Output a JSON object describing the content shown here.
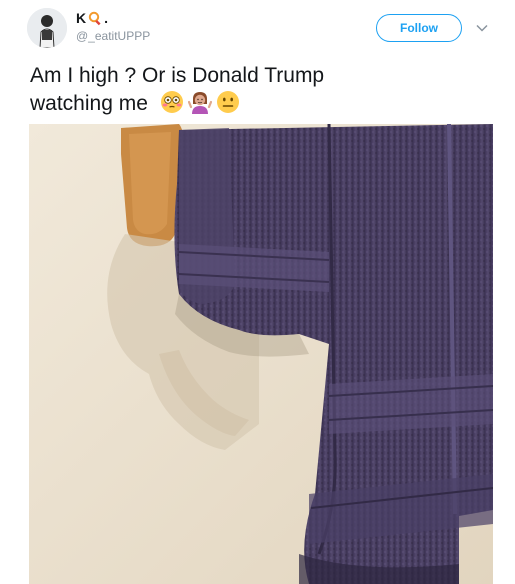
{
  "author": {
    "display_name": "K",
    "name_emojis": [
      "magnifier-emoji-icon",
      "dot"
    ],
    "handle": "@_eatitUPPP"
  },
  "follow_button": {
    "label": "Follow"
  },
  "menu": {
    "icon": "chevron-down-icon"
  },
  "tweet": {
    "line1": "Am I high ? Or is  Donald Trump",
    "line2": "watching me",
    "emojis": [
      "flushed-face-icon",
      "woman-shrugging-icon",
      "neutral-face-icon"
    ]
  },
  "media": {
    "description_icon": "towel-photo",
    "colors": {
      "towel": "#4a3f63",
      "wall": "#ece3d3",
      "holder": "#c98a44"
    }
  },
  "colors": {
    "accent": "#1da1f2",
    "secondary_text": "#8a949e",
    "primary_text": "#14171a"
  }
}
